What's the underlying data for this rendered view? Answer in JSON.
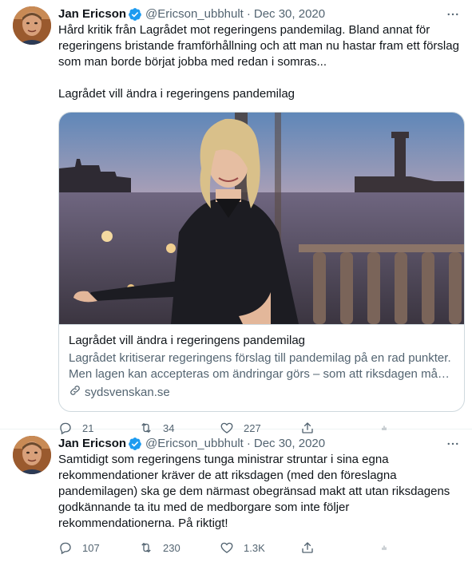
{
  "tweets": [
    {
      "author_name": "Jan Ericson",
      "handle": "@Ericson_ubbhult",
      "separator": "·",
      "date": "Dec 30, 2020",
      "text": "Hård kritik från Lagrådet mot regeringens pandemilag. Bland annat för regeringens bristande framförhållning och att man nu hastar fram ett förslag som man borde börjat jobba med redan i somras...\n\nLagrådet vill ändra i regeringens pandemilag",
      "card": {
        "title": "Lagrådet vill ändra i regeringens pandemilag",
        "description": "Lagrådet kritiserar regeringens förslag till pandemilag på en rad punkter. Men lagen kan accepteras om ändringar görs – som att riksdagen måste få yttra sig.",
        "domain": "sydsvenskan.se"
      },
      "stats": {
        "replies": "21",
        "retweets": "34",
        "likes": "227"
      }
    },
    {
      "author_name": "Jan Ericson",
      "handle": "@Ericson_ubbhult",
      "separator": "·",
      "date": "Dec 30, 2020",
      "text": "Samtidigt som regeringens tunga ministrar struntar i sina egna rekommendationer kräver de att riksdagen (med den föreslagna pandemilagen) ska ge dem närmast obegränsad makt att utan riksdagens godkännande ta itu med de medborgare som inte följer rekommendationerna. På riktigt!",
      "stats": {
        "replies": "107",
        "retweets": "230",
        "likes": "1.3K"
      }
    }
  ],
  "icons": {
    "verified": "verified-badge-icon",
    "more": "more-horizontal-icon",
    "reply": "reply-icon",
    "retweet": "retweet-icon",
    "like": "heart-icon",
    "share": "share-icon",
    "analytics": "analytics-icon",
    "link": "link-icon"
  },
  "colors": {
    "text": "#0f1419",
    "secondary": "#536471",
    "verified": "#1d9bf0",
    "border": "#cfd9de"
  }
}
